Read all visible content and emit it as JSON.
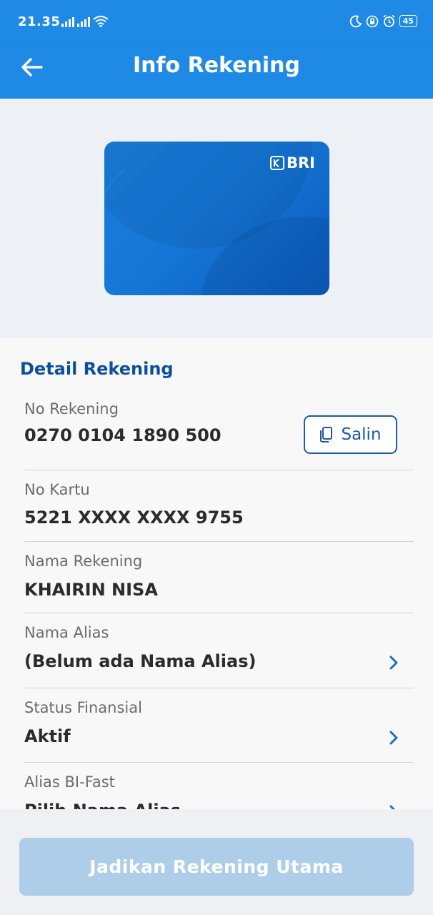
{
  "status_bar": {
    "time": "21.35",
    "battery": "45",
    "icons": [
      "signal-icon",
      "signal-icon",
      "wifi-icon",
      "moon-icon",
      "lock-icon",
      "alarm-icon",
      "battery-icon"
    ]
  },
  "header": {
    "title": "Info Rekening",
    "back_icon": "arrow-left-icon"
  },
  "card": {
    "brand": "BRI",
    "colors": {
      "primary": "#1a7fdc",
      "dark": "#0a5bbf"
    }
  },
  "details": {
    "section_title": "Detail Rekening",
    "rows": [
      {
        "label": "No Rekening",
        "value": "0270 0104 1890 500",
        "action": "Salin",
        "action_icon": "copy-icon"
      },
      {
        "label": "No Kartu",
        "value": "5221 XXXX XXXX 9755"
      },
      {
        "label": "Nama Rekening",
        "value": "KHAIRIN NISA"
      },
      {
        "label": "Nama Alias",
        "value": "(Belum ada Nama Alias)",
        "icon": "chevron-right-icon"
      },
      {
        "label": "Status Finansial",
        "value": "Aktif",
        "icon": "chevron-right-icon"
      },
      {
        "label": "Alias BI-Fast",
        "value": "Pilih Nama Alias",
        "icon": "chevron-right-icon"
      }
    ]
  },
  "footer": {
    "primary_button": "Jadikan Rekening Utama"
  },
  "colors": {
    "accent": "#1f8ae6",
    "title_blue": "#0c4f9c",
    "button_disabled": "#aecde9"
  }
}
